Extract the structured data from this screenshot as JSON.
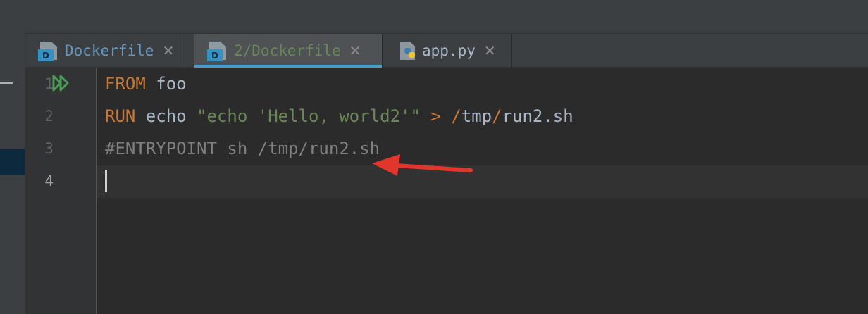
{
  "tabs": [
    {
      "label": "Dockerfile",
      "icon": "dockerfile-icon",
      "color": "#6897bb"
    },
    {
      "label": "2/Dockerfile",
      "icon": "dockerfile-icon",
      "color": "#6a8759",
      "active": true
    },
    {
      "label": "app.py",
      "icon": "python-file-icon",
      "color": "#a9b7c6"
    }
  ],
  "tab_badge": "D",
  "close_glyph": "✕",
  "editor": {
    "line_numbers": [
      "1",
      "2",
      "3",
      "4"
    ],
    "lines": {
      "l1": {
        "kw": "FROM",
        "rest": " foo"
      },
      "l2": {
        "kw": "RUN",
        "cmd": " echo ",
        "str": "\"echo 'Hello, world2'\"",
        "op": " > /",
        "path1": "tmp",
        "slash": "/",
        "path2": "run2.sh"
      },
      "l3": {
        "comment": "#ENTRYPOINT sh /tmp/run2.sh"
      },
      "l4": {
        "text": ""
      }
    }
  },
  "annotation": {
    "type": "red-arrow",
    "color": "#e0362c"
  },
  "colors": {
    "keyword": "#cc7832",
    "string": "#6a8759",
    "comment": "#808080",
    "text": "#a9b7c6",
    "accent": "#4a9cc7",
    "run_icon": "#499c54"
  }
}
